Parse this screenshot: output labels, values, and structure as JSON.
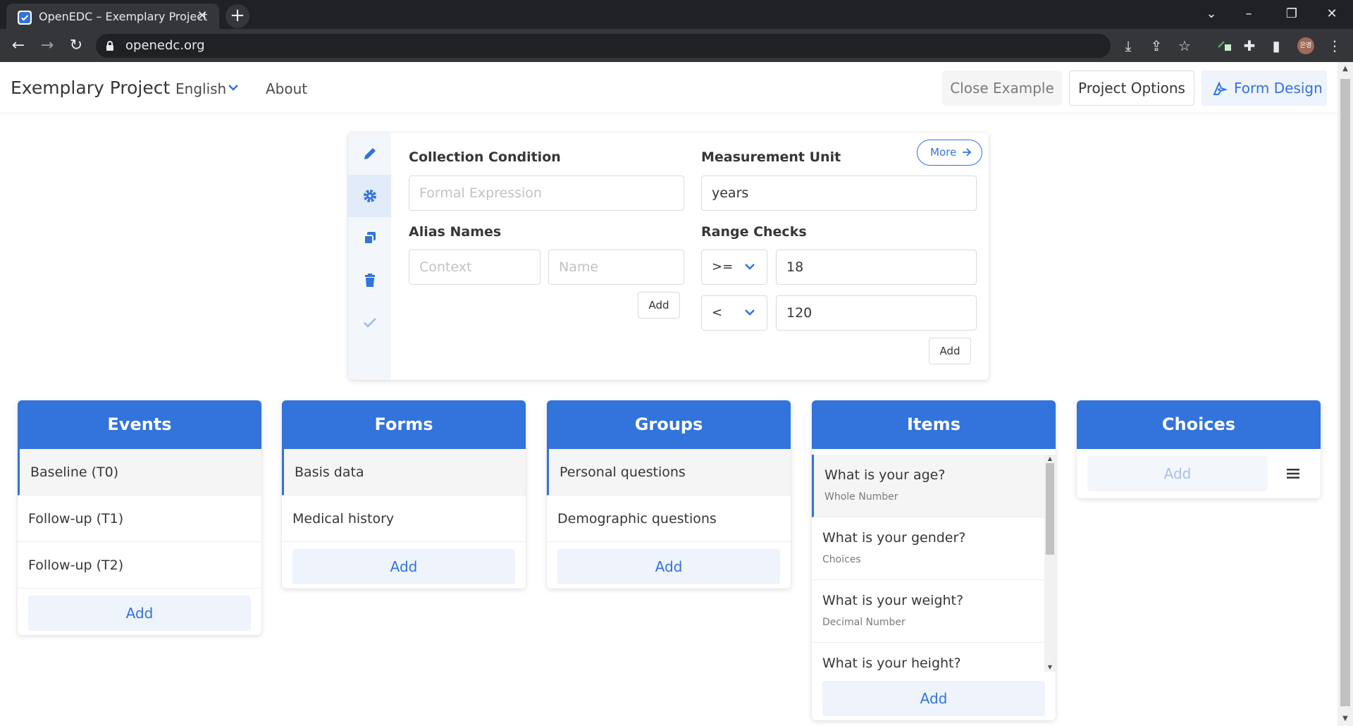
{
  "browser": {
    "tab_title": "OpenEDC – Exemplary Project",
    "url": "openedc.org",
    "profile_initials": "은영"
  },
  "navbar": {
    "project_name": "Exemplary Project",
    "language": "English",
    "about": "About",
    "close_example": "Close Example",
    "project_options": "Project Options",
    "form_design": "Form Design"
  },
  "panel": {
    "collection_condition_label": "Collection Condition",
    "collection_condition_placeholder": "Formal Expression",
    "measurement_unit_label": "Measurement Unit",
    "measurement_unit_value": "years",
    "more": "More",
    "alias_names_label": "Alias Names",
    "alias_context_placeholder": "Context",
    "alias_name_placeholder": "Name",
    "alias_add": "Add",
    "range_checks_label": "Range Checks",
    "range_checks": [
      {
        "operator": ">=",
        "value": "18"
      },
      {
        "operator": "<",
        "value": "120"
      }
    ],
    "range_add": "Add",
    "side_icons": [
      "pencil-icon",
      "gear-icon",
      "copy-icon",
      "trash-icon",
      "check-icon"
    ],
    "active_side_tab": "gear-icon"
  },
  "columns": {
    "events": {
      "title": "Events",
      "rows": [
        "Baseline (T0)",
        "Follow-up (T1)",
        "Follow-up (T2)"
      ],
      "add": "Add"
    },
    "forms": {
      "title": "Forms",
      "rows": [
        "Basis data",
        "Medical history"
      ],
      "add": "Add"
    },
    "groups": {
      "title": "Groups",
      "rows": [
        "Personal questions",
        "Demographic questions"
      ],
      "add": "Add"
    },
    "items": {
      "title": "Items",
      "rows": [
        {
          "question": "What is your age?",
          "type": "Whole Number"
        },
        {
          "question": "What is your gender?",
          "type": "Choices"
        },
        {
          "question": "What is your weight?",
          "type": "Decimal Number"
        },
        {
          "question": "What is your height?",
          "type": ""
        }
      ],
      "add": "Add"
    },
    "choices": {
      "title": "Choices",
      "add": "Add"
    }
  },
  "colors": {
    "primary": "#3273dc",
    "primary_light": "#eef3fc",
    "chrome_dark": "#202124",
    "chrome_toolbar": "#35363a"
  }
}
